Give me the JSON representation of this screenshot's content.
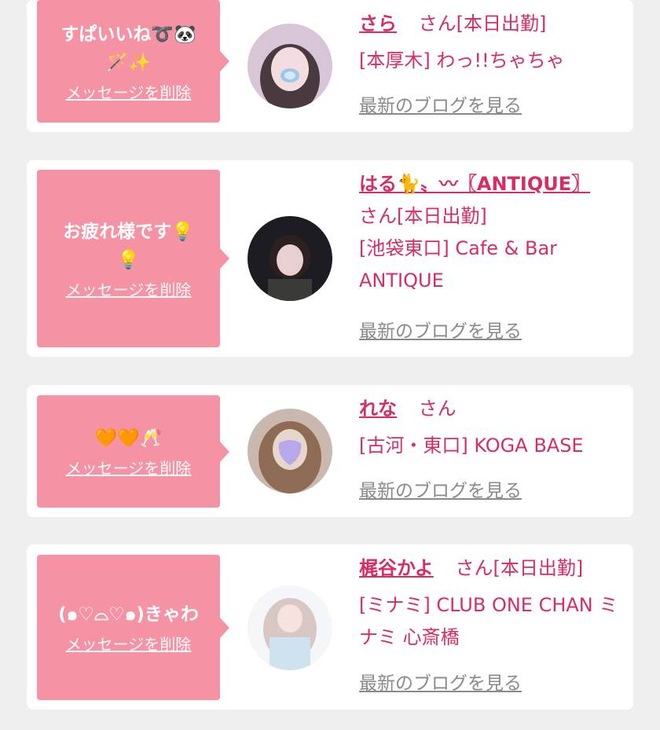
{
  "cards": [
    {
      "message": "すぱいいね➰🐼\n🪄✨",
      "delete_label": "メッセージを削除",
      "name": "さら",
      "suffix": "さん[本日出勤]",
      "shop": "[本厚木] わっ!!ちゃちゃ",
      "blog_label": "最新のブログを見る"
    },
    {
      "message": "お疲れ様です💡\n💡",
      "delete_label": "メッセージを削除",
      "name": "はる🐈〟〰〖ANTIQUE〗",
      "suffix": "さん[本日出勤]",
      "shop": "[池袋東口] Cafe & Bar ANTIQUE",
      "blog_label": "最新のブログを見る"
    },
    {
      "message": "🧡🧡🥂",
      "delete_label": "メッセージを削除",
      "name": "れな",
      "suffix": "さん",
      "shop": "[古河・東口] KOGA BASE",
      "blog_label": "最新のブログを見る"
    },
    {
      "message": "(๑♡⌓♡๑)きゃわ",
      "delete_label": "メッセージを削除",
      "name": "梶谷かよ",
      "suffix": "さん[本日出勤]",
      "shop": "[ミナミ] CLUB ONE CHAN ミナミ 心斎橋",
      "blog_label": "最新のブログを見る"
    }
  ],
  "colors": {
    "accent": "#d62d63",
    "bubble": "#f592a3",
    "background": "#efefef"
  }
}
